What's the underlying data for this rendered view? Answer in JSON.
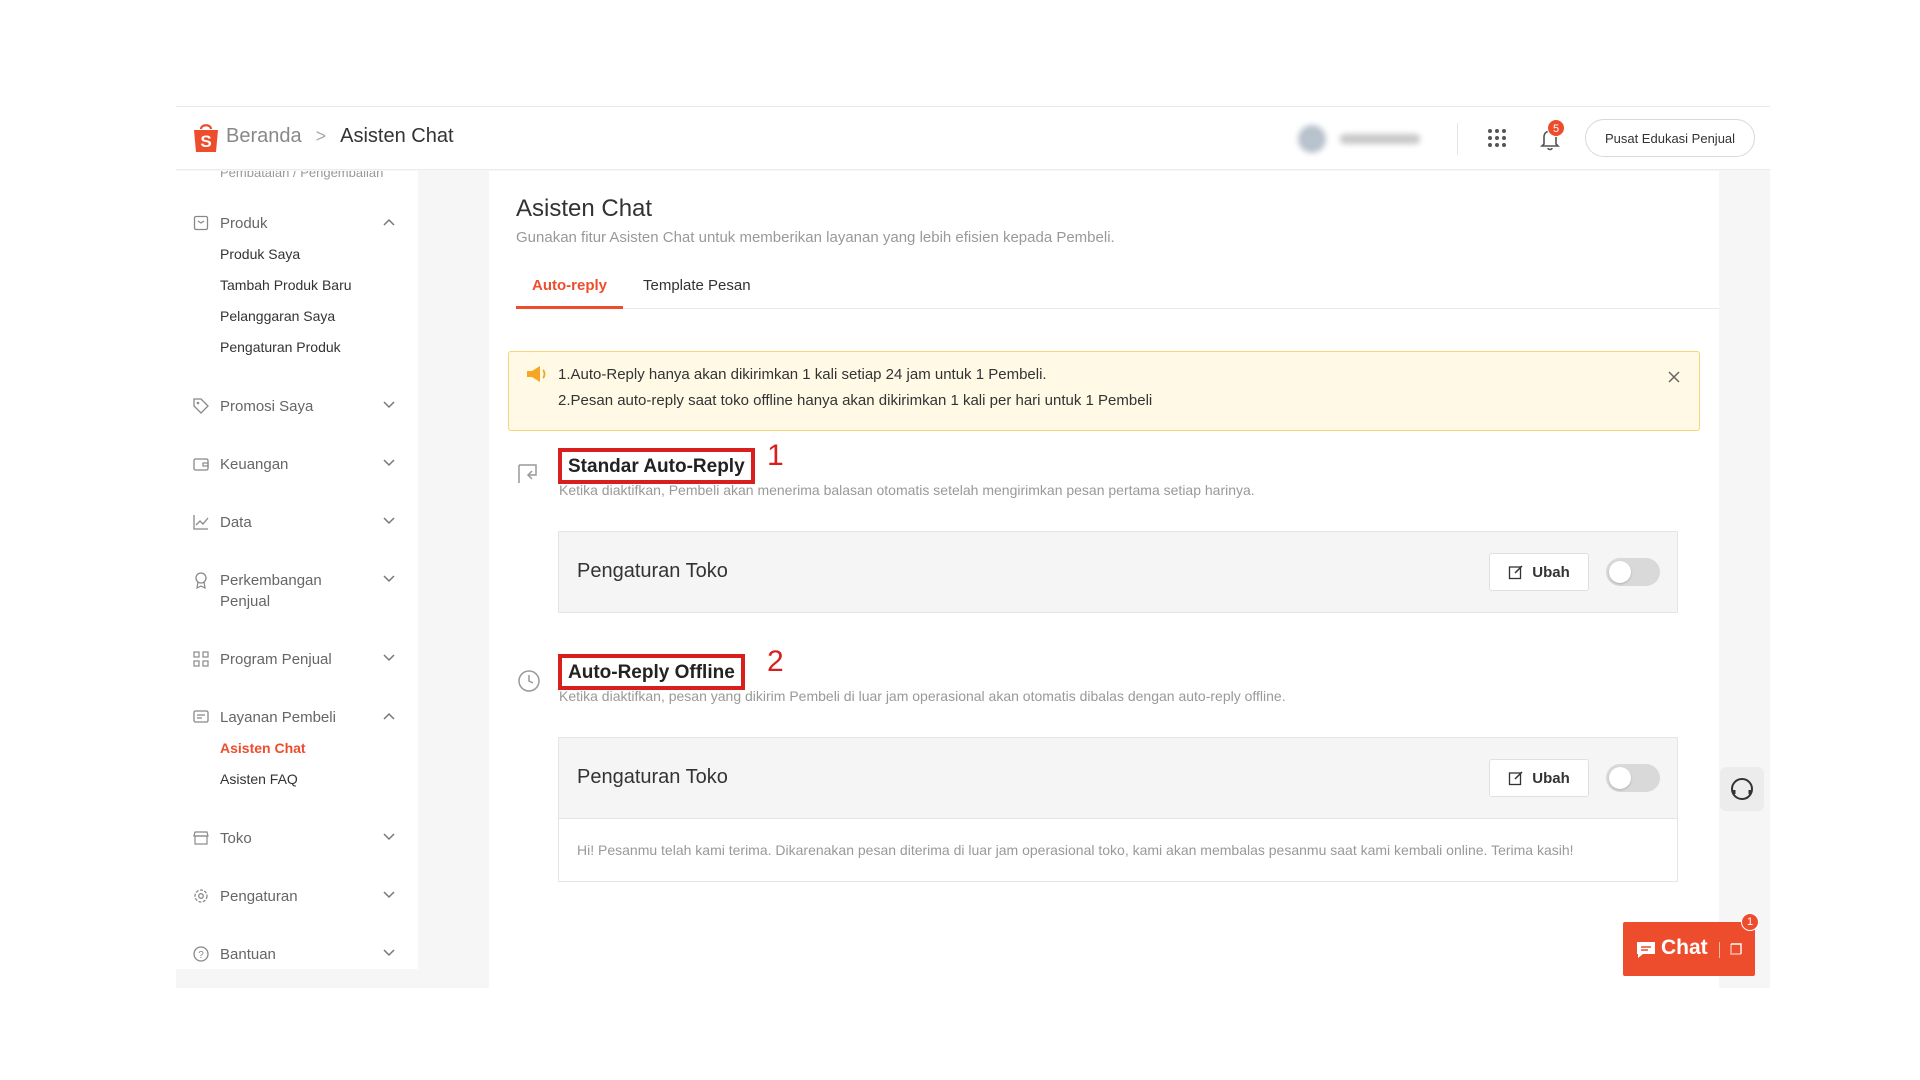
{
  "header": {
    "breadcrumb_home": "Beranda",
    "breadcrumb_sep": ">",
    "breadcrumb_current": "Asisten Chat",
    "notification_count": "5",
    "edu_button": "Pusat Edukasi Penjual"
  },
  "sidebar": {
    "cut_item": "Pembatalan / Pengembalian",
    "groups": [
      {
        "label": "Produk",
        "icon": "clipboard-icon",
        "expanded": true,
        "items": [
          "Produk Saya",
          "Tambah Produk Baru",
          "Pelanggaran Saya",
          "Pengaturan Produk"
        ]
      },
      {
        "label": "Promosi Saya",
        "icon": "tag-icon",
        "expanded": false
      },
      {
        "label": "Keuangan",
        "icon": "wallet-icon",
        "expanded": false
      },
      {
        "label": "Data",
        "icon": "chart-icon",
        "expanded": false
      },
      {
        "label": "Perkembangan Penjual",
        "label_line1": "Perkembangan",
        "label_line2": "Penjual",
        "icon": "medal-icon",
        "expanded": false
      },
      {
        "label": "Program Penjual",
        "icon": "program-icon",
        "expanded": false
      },
      {
        "label": "Layanan Pembeli",
        "icon": "message-icon",
        "expanded": true,
        "items": [
          "Asisten Chat",
          "Asisten FAQ"
        ],
        "active_item": "Asisten Chat"
      },
      {
        "label": "Toko",
        "icon": "shop-icon",
        "expanded": false
      },
      {
        "label": "Pengaturan",
        "icon": "gear-icon",
        "expanded": false
      },
      {
        "label": "Bantuan",
        "icon": "help-icon",
        "expanded": false
      }
    ]
  },
  "main": {
    "title": "Asisten Chat",
    "subtitle": "Gunakan fitur Asisten Chat untuk memberikan layanan yang lebih efisien kepada Pembeli.",
    "tabs": [
      {
        "label": "Auto-reply",
        "active": true
      },
      {
        "label": "Template Pesan",
        "active": false
      }
    ],
    "notice": {
      "line1": "1.Auto-Reply hanya akan dikirimkan 1 kali setiap 24 jam untuk 1 Pembeli.",
      "line2": "2.Pesan auto-reply saat toko offline hanya akan dikirimkan 1 kali per hari untuk 1 Pembeli"
    },
    "sections": [
      {
        "title": "Standar Auto-Reply",
        "annotation": "1",
        "description": "Ketika diaktifkan, Pembeli akan menerima balasan otomatis setelah mengirimkan pesan pertama setiap harinya.",
        "setting_name": "Pengaturan Toko",
        "edit_label": "Ubah",
        "enabled": false
      },
      {
        "title": "Auto-Reply Offline",
        "annotation": "2",
        "description": "Ketika diaktifkan, pesan yang dikirim Pembeli di luar jam operasional akan otomatis dibalas dengan auto-reply offline.",
        "setting_name": "Pengaturan Toko",
        "edit_label": "Ubah",
        "enabled": false,
        "message": "Hi! Pesanmu telah kami terima. Dikarenakan pesan diterima di luar jam operasional toko, kami akan membalas pesanmu saat kami kembali online. Terima kasih!"
      }
    ]
  },
  "chat_widget": {
    "label": "Chat",
    "badge": "1"
  },
  "colors": {
    "brand": "#ee4d2d",
    "annotation": "#d91e1e",
    "notice_bg": "#fff9e6"
  }
}
